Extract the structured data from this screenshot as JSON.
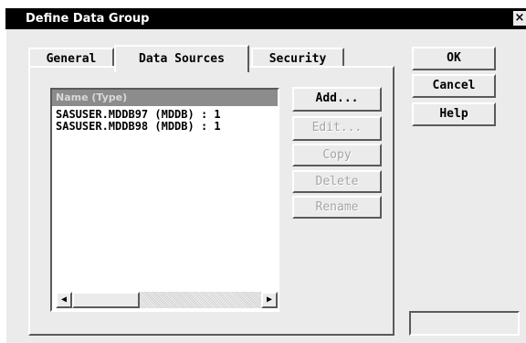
{
  "window": {
    "title": "Define Data Group",
    "close_glyph": "×"
  },
  "tabs": [
    {
      "label": "General",
      "active": false
    },
    {
      "label": "Data Sources",
      "active": true
    },
    {
      "label": "Security",
      "active": false
    }
  ],
  "list": {
    "header": "Name (Type)",
    "items": [
      "SASUSER.MDDB97 (MDDB) : 1",
      "SASUSER.MDDB98 (MDDB) : 1"
    ]
  },
  "list_buttons": {
    "add": "Add...",
    "edit": "Edit...",
    "copy": "Copy",
    "delete": "Delete",
    "rename": "Rename"
  },
  "dialog_buttons": {
    "ok": "OK",
    "cancel": "Cancel",
    "help": "Help"
  },
  "icons": {
    "close": "close-icon",
    "scroll_left": "scroll-left-arrow-icon",
    "scroll_right": "scroll-right-arrow-icon"
  },
  "colors": {
    "title_bar": "#000000",
    "window_bg": "#ebebeb",
    "list_header_bg": "#8c8c8c",
    "disabled_text": "#a5a5a5"
  }
}
